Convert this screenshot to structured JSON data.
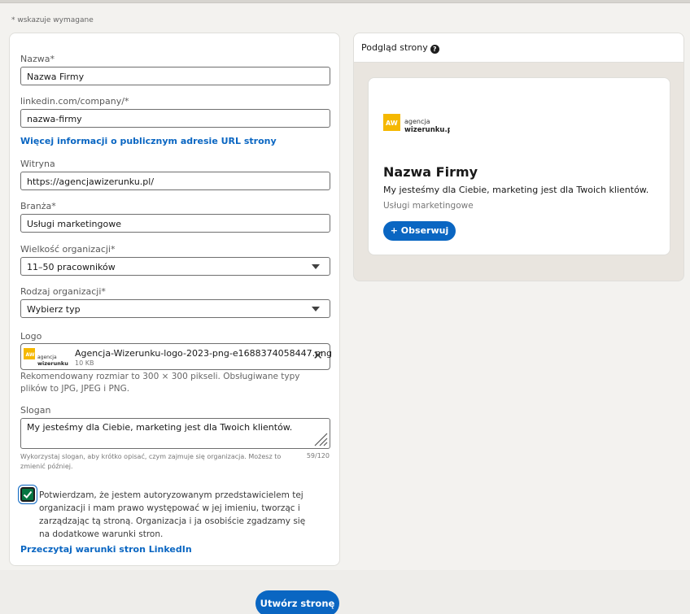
{
  "required_note": "* wskazuje wymagane",
  "form": {
    "name_label": "Nazwa*",
    "name_value": "Nazwa Firmy",
    "url_label": "linkedin.com/company/*",
    "url_value": "nazwa-firmy",
    "url_info_link": "Więcej informacji o publicznym adresie URL strony",
    "website_label": "Witryna",
    "website_value": "https://agencjawizerunku.pl/",
    "industry_label": "Branża*",
    "industry_value": "Usługi marketingowe",
    "size_label": "Wielkość organizacji*",
    "size_value": "11–50 pracowników",
    "type_label": "Rodzaj organizacji*",
    "type_value": "Wybierz typ",
    "logo_label": "Logo",
    "logo_filename": "Agencja-Wizerunku-logo-2023-png-e1688374058447.png",
    "logo_filesize": "10 KB",
    "logo_help": "Rekomendowany rozmiar to 300 × 300 pikseli. Obsługiwane typy plików to JPG, JPEG i PNG.",
    "slogan_label": "Slogan",
    "slogan_value": "My jesteśmy dla Ciebie, marketing jest dla Twoich klientów.",
    "slogan_help": "Wykorzystaj slogan, aby krótko opisać, czym zajmuje się organizacja. Możesz to zmienić później.",
    "slogan_count": "59/120",
    "consent_text": "Potwierdzam, że jestem autoryzowanym przedstawicielem tej organizacji i mam prawo występować w jej imieniu, tworząc i zarządzając tą stroną. Organizacja i ja osobiście zgadzamy się na dodatkowe warunki stron.",
    "consent_checked": true,
    "terms_link": "Przeczytaj warunki stron LinkedIn"
  },
  "preview": {
    "title": "Podgląd strony",
    "help_icon": "?",
    "company_name": "Nazwa Firmy",
    "slogan": "My jesteśmy dla Ciebie, marketing jest dla Twoich klientów.",
    "industry": "Usługi marketingowe",
    "follow_label": "+ Obserwuj"
  },
  "logo_brand": {
    "mark": "AW",
    "line1": "agencja",
    "line2": "wizerunku.pl"
  },
  "create_button": "Utwórz stronę",
  "colors": {
    "accent": "#0a66c2",
    "checkbox": "#057642",
    "logo_yellow": "#f5b800"
  }
}
